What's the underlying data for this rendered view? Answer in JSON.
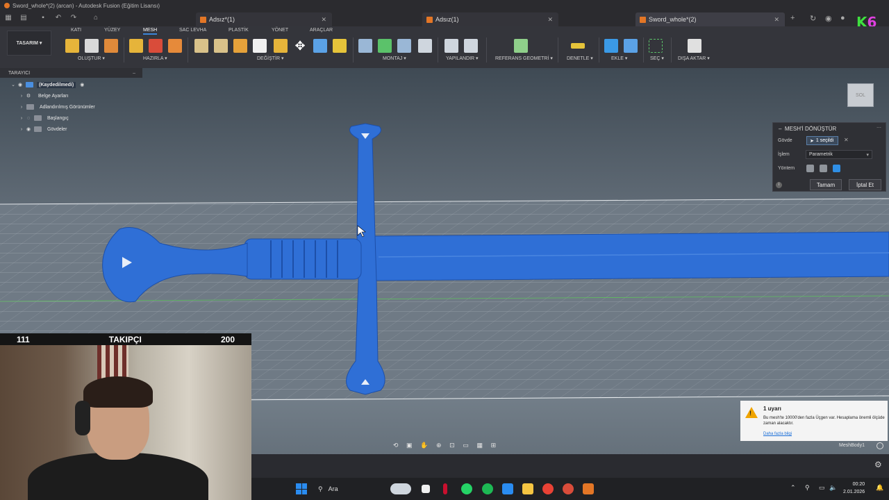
{
  "window": {
    "title": "Sword_whole*(2) (arcan) - Autodesk Fusion (Eğitim Lisansı)"
  },
  "tabs": [
    {
      "label": "Adsız*(1)"
    },
    {
      "label": "Adsız(1)"
    },
    {
      "label": "Sword_whole*(2)"
    }
  ],
  "ribbon": {
    "workspace": "TASARIM",
    "tabs": [
      "KATI",
      "YÜZEY",
      "MESH",
      "SAC LEVHA",
      "PLASTİK",
      "YÖNET",
      "ARAÇLAR"
    ],
    "groups": [
      "OLUŞTUR",
      "HAZIRLA",
      "DEĞİŞTİR",
      "MONTAJ",
      "YAPILANDIR",
      "REFERANS GEOMETRİ",
      "DENETLE",
      "EKLE",
      "SEÇ",
      "DIŞA AKTAR"
    ]
  },
  "browser": {
    "header": "TARAYICI",
    "root": "(Kaydedilmedi)",
    "items": [
      "Belge Ayarları",
      "Adlandırılmış Görünümler",
      "Başlangıç",
      "Gövdeler"
    ]
  },
  "viewcube": {
    "face": "SOL"
  },
  "dialog": {
    "title": "MESH'İ DÖNÜŞTÜR",
    "body_label": "Gövde",
    "body_value": "1 seçildi",
    "operation_label": "İşlem",
    "operation_value": "Parametrik",
    "method_label": "Yöntem",
    "ok": "Tamam",
    "cancel": "İptal Et"
  },
  "overlay": {
    "left": "111",
    "label": "TAKIPÇI",
    "right": "200",
    "brand_k": "K",
    "brand_6": "6"
  },
  "warning": {
    "title": "1 uyarı",
    "body": "Bu mesh'te 10000'den fazla Üçgen var. Hesaplama önemli ölçüde zaman alacaktır.",
    "link": "Daha fazla bilgi"
  },
  "status": {
    "mesh_body": "MeshBody1"
  },
  "taskbar": {
    "search": "Ara",
    "time": "00:20",
    "date": "2.01.2026"
  },
  "colors": {
    "accent": "#3b86d9",
    "mesh_blue": "#2f6fd6",
    "warning": "#f0a400",
    "fusion_orange": "#e37626"
  }
}
